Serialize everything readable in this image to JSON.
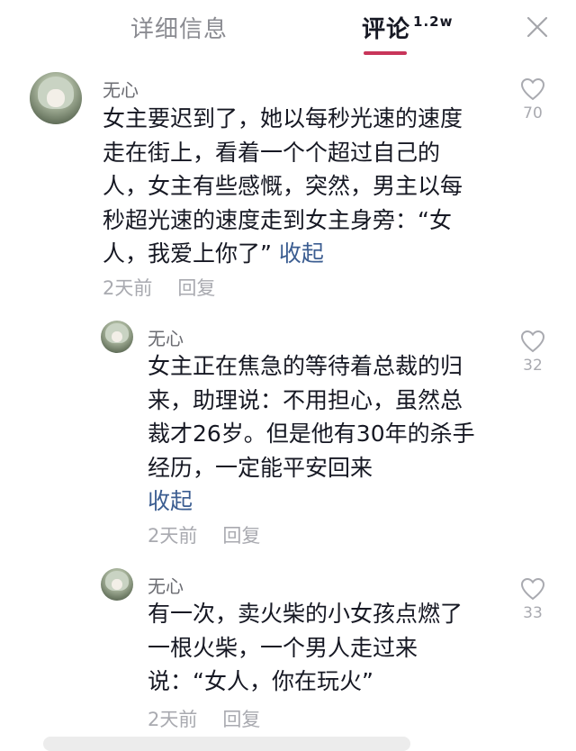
{
  "header": {
    "tab_details": "详细信息",
    "tab_comments": "评论",
    "comment_count": "1.2w"
  },
  "comments": [
    {
      "username": "无心",
      "text": "女主要迟到了，她以每秒光速的速度走在街上，看着一个个超过自己的人，女主有些感慨，突然，男主以每秒超光速的速度走到女主身旁：“女人，我爱上你了”",
      "collapse": "收起",
      "time": "2天前",
      "reply": "回复",
      "likes": "70"
    },
    {
      "username": "无心",
      "text": "女主正在焦急的等待着总裁的归来，助理说：不用担心，虽然总裁才26岁。但是他有30年的杀手经历，一定能平安回来",
      "collapse": "收起",
      "time": "2天前",
      "reply": "回复",
      "likes": "32"
    },
    {
      "username": "无心",
      "text": "有一次，卖火柴的小女孩点燃了一根火柴，一个男人走过来说：“女人，你在玩火”",
      "time": "2天前",
      "reply": "回复",
      "likes": "33"
    }
  ],
  "colors": {
    "accent": "#c8355a",
    "link": "#3b5d91",
    "muted": "#a9aab0"
  }
}
